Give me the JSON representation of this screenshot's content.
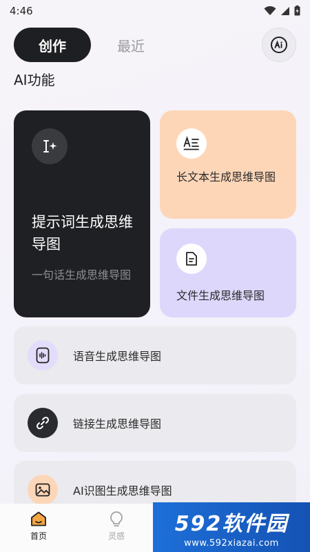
{
  "status": {
    "time": "4:46"
  },
  "tabs": {
    "create": "创作",
    "recent": "最近"
  },
  "section_title": "AI功能",
  "cards": {
    "prompt": {
      "title": "提示词生成思维导图",
      "subtitle": "一句话生成思维导图"
    },
    "longtext": {
      "label": "长文本生成思维导图"
    },
    "file": {
      "label": "文件生成思维导图"
    }
  },
  "list": [
    {
      "label": "语音生成思维导图",
      "icon": "voice-icon",
      "icon_bg": "#e3ddfb"
    },
    {
      "label": "链接生成思维导图",
      "icon": "link-icon",
      "icon_bg": "#2a2b2f"
    },
    {
      "label": "AI识图生成思维导图",
      "icon": "image-icon",
      "icon_bg": "#fcd6b8"
    }
  ],
  "nav": {
    "home": "首页",
    "inspiration": "灵感"
  },
  "watermark": {
    "brand": "592软件园",
    "url": "www.592xiazai.com"
  },
  "colors": {
    "dark": "#1f2023",
    "orange": "#fdd6b8",
    "purple": "#dcd7fb",
    "accent_home": "#f4a640"
  }
}
